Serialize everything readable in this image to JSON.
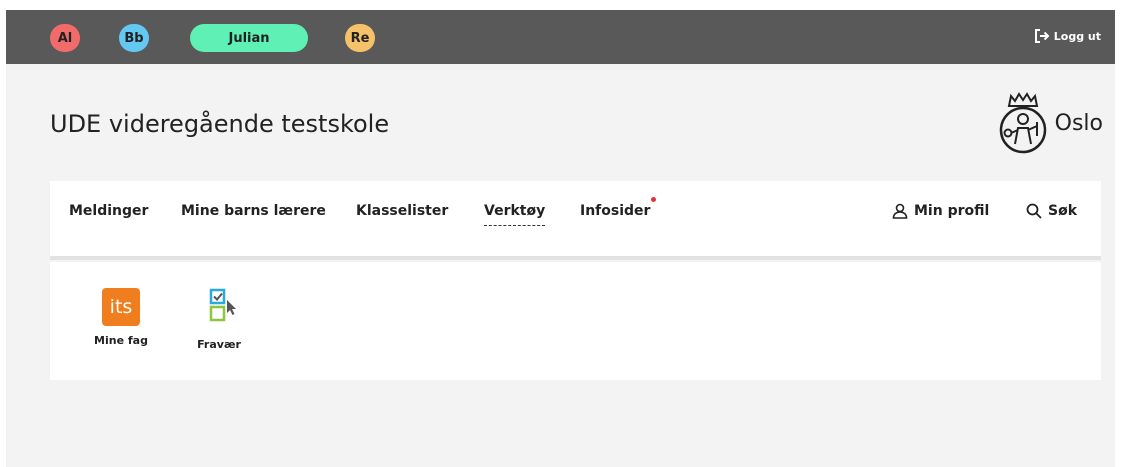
{
  "topbar": {
    "children": [
      {
        "label": "Al",
        "color": "#f26b6b"
      },
      {
        "label": "Bb",
        "color": "#63c8f2"
      },
      {
        "label": "Julian",
        "color": "#5ef0b4"
      },
      {
        "label": "Re",
        "color": "#f5c26a"
      }
    ],
    "logout_label": "Logg ut",
    "logout_icon": "logout-arrow-icon"
  },
  "header": {
    "title": "UDE videregående testskole",
    "logo_text": "Oslo",
    "logo_icon": "oslo-seal-icon"
  },
  "nav": {
    "items": [
      {
        "label": "Meldinger"
      },
      {
        "label": "Mine barns lærere"
      },
      {
        "label": "Klasselister"
      },
      {
        "label": "Verktøy",
        "active": true
      },
      {
        "label": "Infosider",
        "notification": true
      }
    ],
    "profile_label": "Min profil",
    "profile_icon": "person-icon",
    "search_label": "Søk",
    "search_icon": "search-icon"
  },
  "tools": [
    {
      "label": "Mine fag",
      "icon": "its-icon",
      "icon_text": "its",
      "color": "#f07d1e"
    },
    {
      "label": "Fravær",
      "icon": "checkbox-cursor-icon"
    }
  ],
  "colors": {
    "topbar": "#595959",
    "background": "#f3f3f3",
    "notification_dot": "#e4313c"
  }
}
